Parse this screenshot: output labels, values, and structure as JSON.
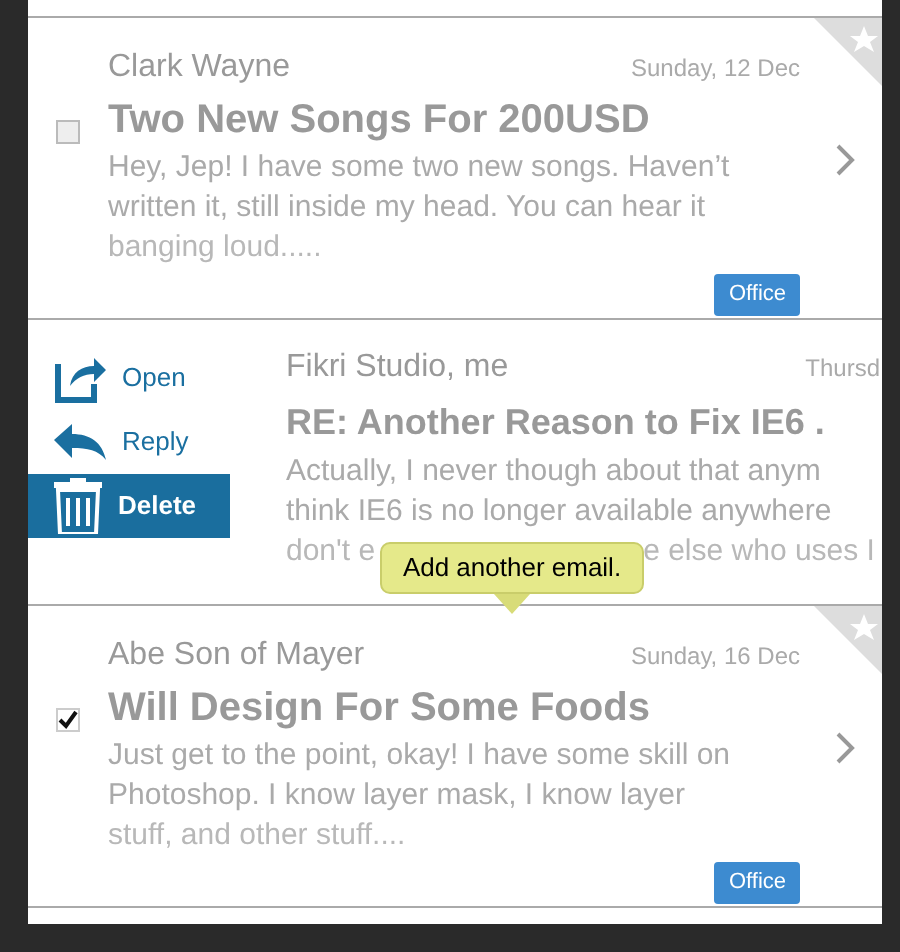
{
  "emails": [
    {
      "kind": "message",
      "sender": "Clark Wayne",
      "date": "Sunday, 12 Dec",
      "subject": "Two New Songs For 200USD",
      "preview_lines": [
        "Hey, Jep! I have some two new songs. Haven’t",
        "written it, still inside my head. You can hear it",
        "banging loud....."
      ],
      "checked": false,
      "label": "Office"
    },
    {
      "kind": "swiped",
      "actions": [
        {
          "kind": "open",
          "label": "Open",
          "selected": false
        },
        {
          "kind": "reply",
          "label": "Reply",
          "selected": false
        },
        {
          "kind": "delete",
          "label": "Delete",
          "selected": true
        }
      ],
      "sender": "Fikri Studio, me",
      "date": "Thursd",
      "subject": "RE: Another Reason to Fix IE6 .",
      "preview_lines": [
        "Actually, I never though about that anym",
        "think IE6 is no longer available anywhere"
      ],
      "covered_line": [
        "don't e",
        "e else who uses I"
      ]
    },
    {
      "kind": "message",
      "sender": "Abe Son of Mayer",
      "date": "Sunday, 16 Dec",
      "subject": "Will Design For Some Foods",
      "preview_lines": [
        "Just get to the point, okay! I have some skill on",
        "Photoshop. I know layer mask, I know layer",
        "stuff, and other stuff...."
      ],
      "checked": true,
      "label": "Office"
    }
  ],
  "tooltip": {
    "text": "Add another email."
  }
}
